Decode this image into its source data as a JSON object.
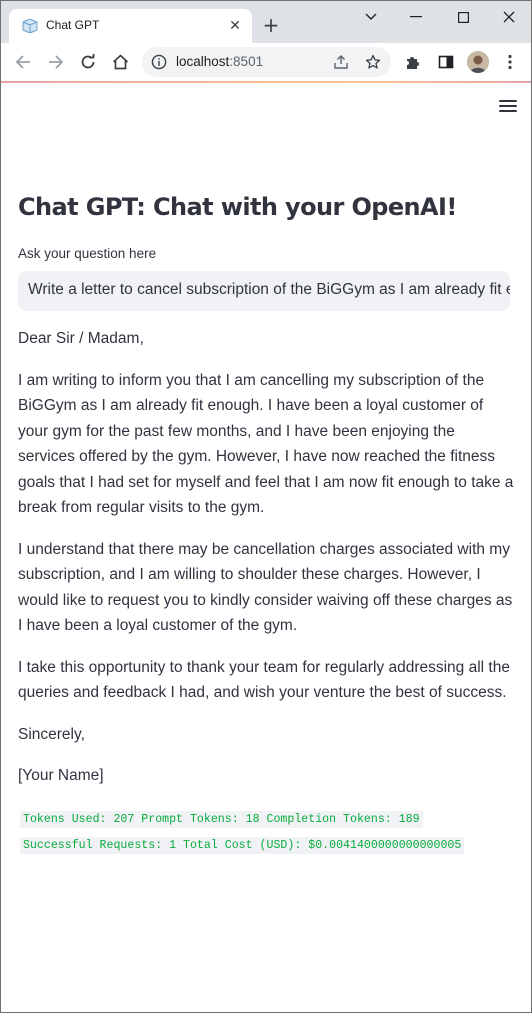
{
  "browser": {
    "tab_title": "Chat GPT",
    "url_host": "localhost",
    "url_port": ":8501"
  },
  "page": {
    "title": "Chat GPT: Chat with your OpenAI!",
    "question_label": "Ask your question here",
    "question_value": "Write a letter to cancel subscription of the BiGGym as I am already fit en",
    "answer": {
      "salutation": "Dear Sir / Madam,",
      "p1": "I am writing to inform you that I am cancelling my subscription of the BiGGym as I am already fit enough. I have been a loyal customer of your gym for the past few months, and I have been enjoying the services offered by the gym. However, I have now reached the fitness goals that I had set for myself and feel that I am now fit enough to take a break from regular visits to the gym.",
      "p2": "I understand that there may be cancellation charges associated with my subscription, and I am willing to shoulder these charges. However, I would like to request you to kindly consider waiving off these charges as I have been a loyal customer of the gym.",
      "p3": "I take this opportunity to thank your team for regularly addressing all the queries and feedback I had, and wish your venture the best of success.",
      "closing": "Sincerely,",
      "name": "[Your Name]"
    },
    "stats": {
      "line1": "Tokens Used: 207 Prompt Tokens: 18 Completion Tokens: 189",
      "line2": "Successful Requests: 1 Total Cost (USD): $0.0041400000000000005"
    }
  },
  "icons": [
    "favicon-icon",
    "close-icon",
    "plus-icon",
    "chevron-down-icon",
    "minimize-icon",
    "maximize-icon",
    "window-close-icon",
    "back-icon",
    "forward-icon",
    "reload-icon",
    "home-icon",
    "info-icon",
    "share-icon",
    "star-icon",
    "extension-icon",
    "sidepanel-icon",
    "avatar",
    "more-icon",
    "hamburger-icon"
  ],
  "colors": {
    "accent_text": "#31333f",
    "input_bg": "#f0f2f6",
    "stats_green": "#09ab3b"
  }
}
